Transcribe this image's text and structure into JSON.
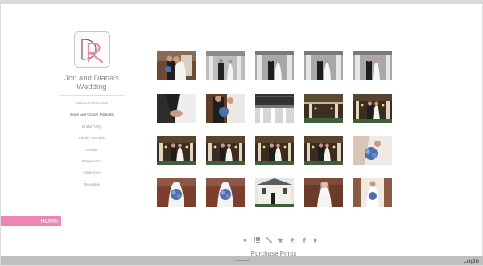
{
  "brand": {
    "logo_monogram": "DR",
    "logo_accent_color": "#e58ab0",
    "logo_dark_color": "#6b6b6b",
    "title": "Jon and Diana's Wedding"
  },
  "nav": {
    "items": [
      {
        "label": "Deborah's Favorites",
        "active": false
      },
      {
        "label": "Bride and Groom Portraits",
        "active": true
      },
      {
        "label": "Bridal Party",
        "active": false
      },
      {
        "label": "Family Portraits",
        "active": false
      },
      {
        "label": "Details",
        "active": false
      },
      {
        "label": "Preparation",
        "active": false
      },
      {
        "label": "Ceremony",
        "active": false
      },
      {
        "label": "Reception",
        "active": false
      }
    ],
    "home_label": "HOME",
    "home_color": "#ee86b2"
  },
  "gallery": {
    "thumbnails": [
      {
        "kind": "couple-porch"
      },
      {
        "kind": "bw-columns"
      },
      {
        "kind": "bw-columns-couple"
      },
      {
        "kind": "bw-columns-couple"
      },
      {
        "kind": "bw-columns-couple"
      },
      {
        "kind": "hands-suit"
      },
      {
        "kind": "couple-bouquet"
      },
      {
        "kind": "bw-building"
      },
      {
        "kind": "porch-lights"
      },
      {
        "kind": "couple-porch-lights"
      },
      {
        "kind": "couple-porch-lights"
      },
      {
        "kind": "couple-porch-lights"
      },
      {
        "kind": "couple-porch-lights"
      },
      {
        "kind": "couple-porch-lights"
      },
      {
        "kind": "bouquet-closeup"
      },
      {
        "kind": "bouquet-dress"
      },
      {
        "kind": "bouquet-dress"
      },
      {
        "kind": "house-couple"
      },
      {
        "kind": "bride-portrait"
      },
      {
        "kind": "bride-bouquet"
      }
    ]
  },
  "toolbar": {
    "icons": [
      "prev-icon",
      "grid-icon",
      "fullscreen-icon",
      "star-icon",
      "download-icon",
      "facebook-icon",
      "next-icon"
    ],
    "purchase_label": "Purchase Prints"
  },
  "footer": {
    "login_label": "Login"
  }
}
